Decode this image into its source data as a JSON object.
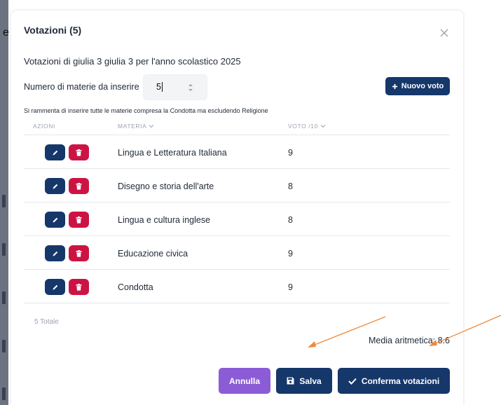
{
  "background": {
    "letter": "e"
  },
  "modal": {
    "title": "Votazioni (5)",
    "subtitle": "Votazioni di giulia 3 giulia 3 per l'anno scolastico 2025",
    "count_label": "Numero di materie da inserire",
    "count_value": "5",
    "new_vote_label": "Nuovo voto",
    "note": "Si rammenta di inserire tutte le materie compresa la Condotta ma escludendo Religione"
  },
  "table": {
    "headers": {
      "actions": "AZIONI",
      "subject": "MATERIA",
      "grade": "VOTO /10"
    },
    "rows": [
      {
        "subject": "Lingua e Letteratura Italiana",
        "grade": "9"
      },
      {
        "subject": "Disegno e storia dell'arte",
        "grade": "8"
      },
      {
        "subject": "Lingua e cultura inglese",
        "grade": "8"
      },
      {
        "subject": "Educazione civica",
        "grade": "9"
      },
      {
        "subject": "Condotta",
        "grade": "9"
      }
    ],
    "total": "5 Totale"
  },
  "summary": {
    "average": "Media aritmetica: 8.6"
  },
  "footer": {
    "cancel_label": "Annulla",
    "save_label": "Salva",
    "confirm_label": "Conferma votazioni"
  },
  "colors": {
    "primary": "#15376a",
    "danger": "#cc1444",
    "cancel": "#8b5cd6",
    "annotation_arrow": "#f08a3c"
  },
  "icons": {
    "close": "close-icon",
    "plus": "plus-icon",
    "edit": "pencil-icon",
    "delete": "trash-icon",
    "save": "floppy-disk-icon",
    "confirm": "check-icon",
    "spinner": "stepper-arrows-icon",
    "sort": "chevron-down-icon"
  }
}
